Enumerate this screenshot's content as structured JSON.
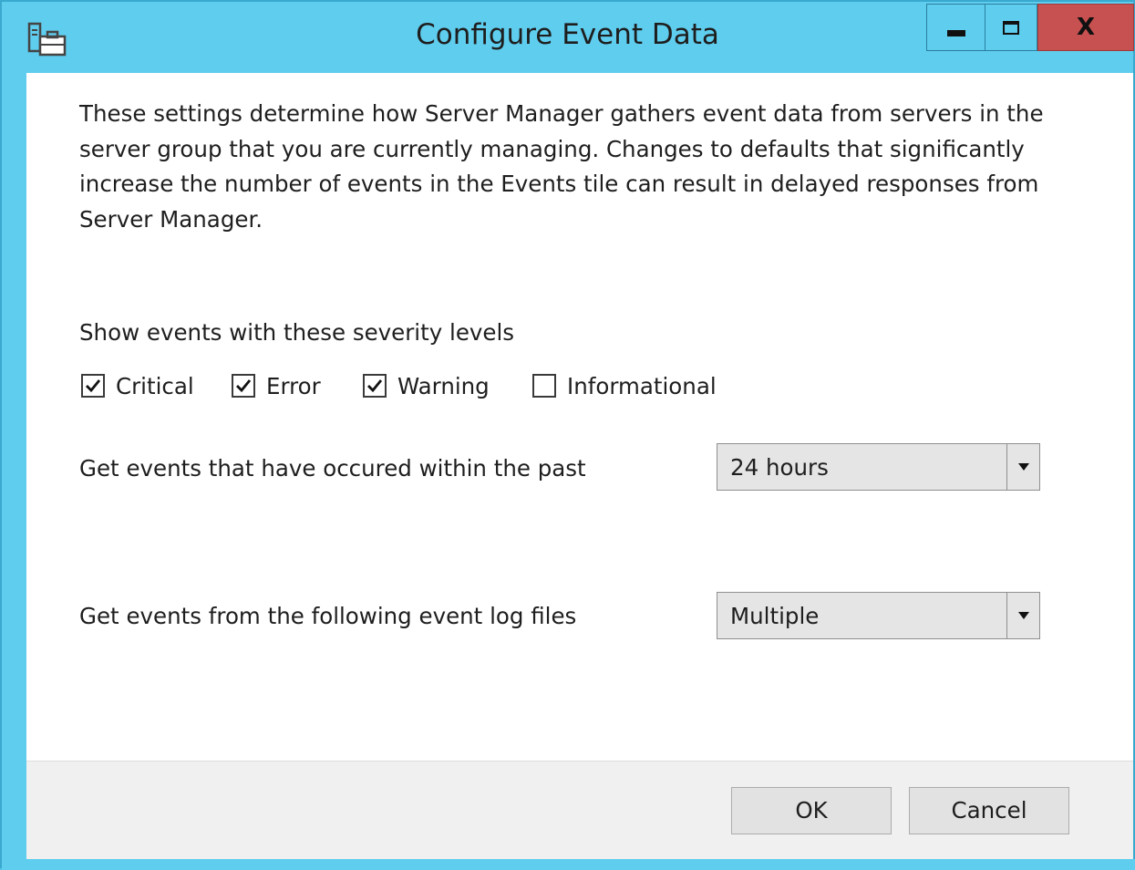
{
  "window": {
    "title": "Configure Event Data",
    "icon": "server-manager-app-icon",
    "controls": {
      "minimize_icon": "minimize-icon",
      "maximize_icon": "maximize-icon",
      "close_label": "X"
    },
    "accent_color": "#5fcdee",
    "close_color": "#c75050"
  },
  "description": "These settings determine how Server Manager gathers event data from servers in the server group that you are currently managing. Changes to defaults that significantly increase the number of events in the Events tile can result in delayed responses from Server Manager.",
  "severity": {
    "label": "Show events with these severity levels",
    "options": [
      {
        "label": "Critical",
        "checked": true
      },
      {
        "label": "Error",
        "checked": true
      },
      {
        "label": "Warning",
        "checked": true
      },
      {
        "label": "Informational",
        "checked": false
      }
    ]
  },
  "time_range": {
    "label": "Get events that have occured within the past",
    "value": "24 hours"
  },
  "log_files": {
    "label": "Get events from the following event log files",
    "value": "Multiple"
  },
  "buttons": {
    "ok": "OK",
    "cancel": "Cancel"
  }
}
